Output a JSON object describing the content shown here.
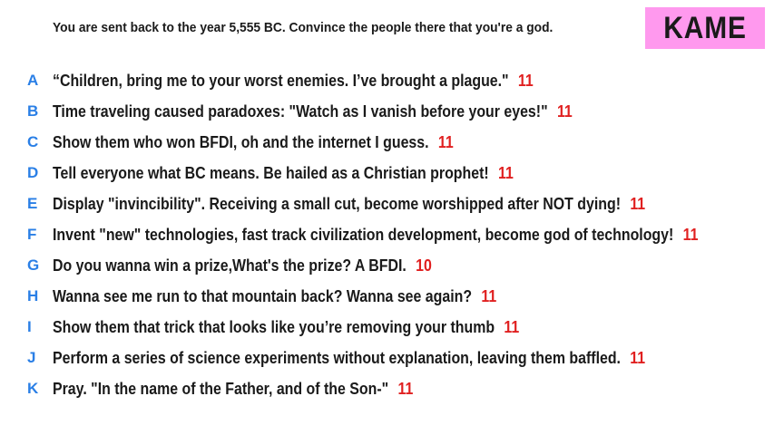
{
  "header": {
    "prompt": "You are sent back to the year 5,555 BC. Convince the people there that you're a god.",
    "team": "KAME"
  },
  "colors": {
    "letter": "#2a7fe6",
    "score": "#e02020",
    "badge": "#ff99ee",
    "text": "#1a1a1a"
  },
  "answers": [
    {
      "letter": "A",
      "text": "“Children, bring me to your worst enemies.  I’ve brought a plague.\"",
      "score": "11"
    },
    {
      "letter": "B",
      "text": "Time traveling caused paradoxes: \"Watch as I vanish before your eyes!\"",
      "score": "11"
    },
    {
      "letter": "C",
      "text": "Show them who won BFDI, oh and the internet I guess.",
      "score": "11"
    },
    {
      "letter": "D",
      "text": "Tell everyone what BC means. Be hailed as a Christian prophet!",
      "score": "11"
    },
    {
      "letter": "E",
      "text": "Display \"invincibility\". Receiving a small cut, become worshipped after NOT dying!",
      "score": "11"
    },
    {
      "letter": "F",
      "text": "Invent \"new\" technologies, fast track civilization development, become god of technology!",
      "score": "11"
    },
    {
      "letter": "G",
      "text": "Do you wanna win a prize,What's the prize? A BFDI.",
      "score": "10"
    },
    {
      "letter": "H",
      "text": "Wanna see me run to that mountain back? Wanna see again?",
      "score": "11"
    },
    {
      "letter": "I",
      "text": "Show them that trick that looks like you’re removing your thumb",
      "score": "11"
    },
    {
      "letter": "J",
      "text": "Perform a series of science experiments without explanation, leaving them baffled.",
      "score": "11"
    },
    {
      "letter": "K",
      "text": "Pray. \"In the name of the Father, and of the Son-\"",
      "score": "11"
    }
  ]
}
